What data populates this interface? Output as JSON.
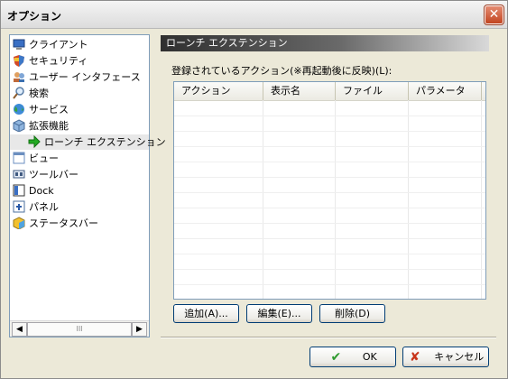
{
  "window": {
    "title": "オプション"
  },
  "tree": {
    "items": [
      {
        "label": "クライアント",
        "icon": "monitor-icon"
      },
      {
        "label": "セキュリティ",
        "icon": "shield-icon"
      },
      {
        "label": "ユーザー インタフェース",
        "icon": "users-icon"
      },
      {
        "label": "検索",
        "icon": "search-icon"
      },
      {
        "label": "サービス",
        "icon": "globe-icon"
      },
      {
        "label": "拡張機能",
        "icon": "box-icon"
      },
      {
        "label": "ローンチ エクステンション",
        "icon": "green-arrow-icon"
      },
      {
        "label": "ビュー",
        "icon": "view-icon"
      },
      {
        "label": "ツールバー",
        "icon": "toolbar-icon"
      },
      {
        "label": "Dock",
        "icon": "dock-icon"
      },
      {
        "label": "パネル",
        "icon": "panel-icon"
      },
      {
        "label": "ステータスバー",
        "icon": "cube-icon"
      }
    ],
    "scroll_thumb_grip": "III"
  },
  "panel": {
    "header": "ローンチ エクステンション",
    "list_label": "登録されているアクション(※再起動後に反映)(L):",
    "columns": [
      "アクション",
      "表示名",
      "ファイル",
      "パラメータ"
    ],
    "rows": []
  },
  "buttons": {
    "add": "追加(A)...",
    "edit": "編集(E)...",
    "delete": "削除(D)",
    "ok": "OK",
    "cancel": "キャンセル"
  },
  "colors": {
    "accent_ok": "#2e9a2e",
    "accent_cancel": "#c8351b",
    "selected_arrow": "#22aa22"
  }
}
